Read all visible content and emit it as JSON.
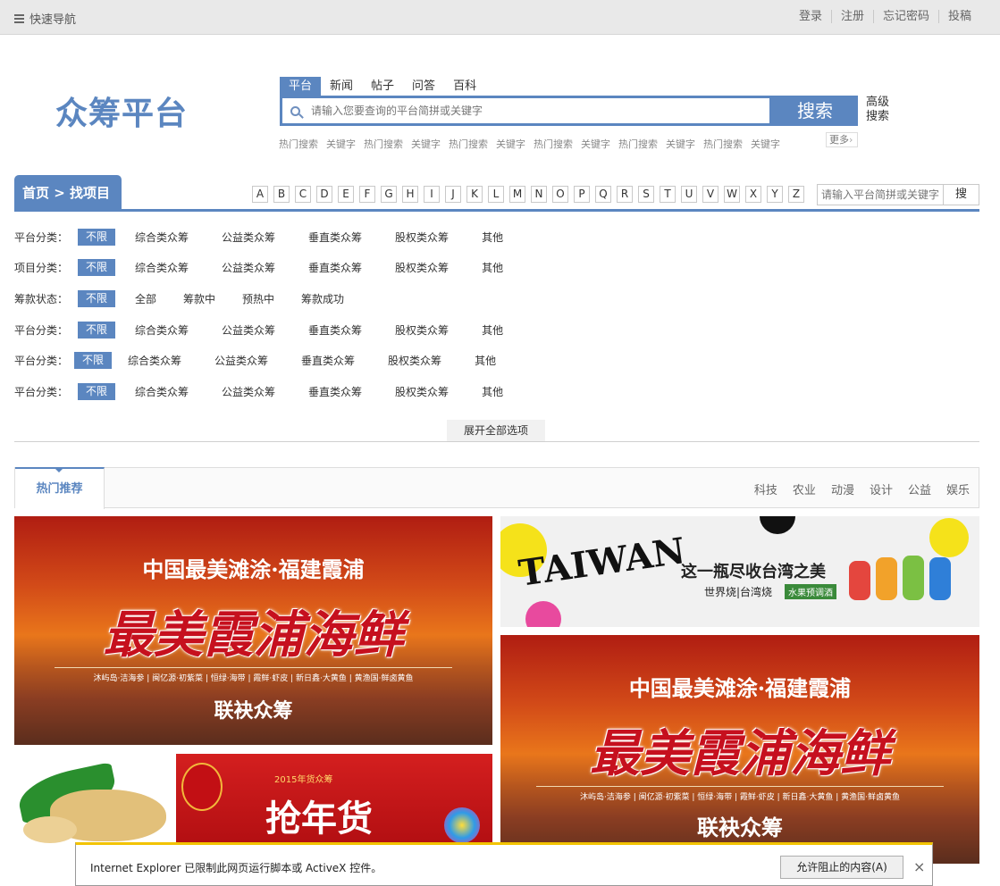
{
  "topbar": {
    "quick_nav": "快速导航",
    "links": [
      "登录",
      "注册",
      "忘记密码",
      "投稿"
    ]
  },
  "logo": "众筹平台",
  "search": {
    "tabs": [
      "平台",
      "新闻",
      "帖子",
      "问答",
      "百科"
    ],
    "placeholder": "请输入您要查询的平台简拼或关键字",
    "button": "搜索",
    "advanced_1": "高级",
    "advanced_2": "搜索",
    "hot": [
      "热门搜索",
      "关键字",
      "热门搜索",
      "关键字",
      "热门搜索",
      "关键字",
      "热门搜索",
      "关键字",
      "热门搜索",
      "关键字",
      "热门搜索",
      "关键字"
    ],
    "more": "更多"
  },
  "breadcrumb": "首页 > 找项目",
  "letters": [
    "A",
    "B",
    "C",
    "D",
    "E",
    "F",
    "G",
    "H",
    "I",
    "J",
    "K",
    "L",
    "M",
    "N",
    "O",
    "P",
    "Q",
    "R",
    "S",
    "T",
    "U",
    "V",
    "W",
    "X",
    "Y",
    "Z"
  ],
  "small_search": {
    "placeholder": "请输入平台简拼或关键字",
    "button": "搜"
  },
  "filters": [
    {
      "label": "平台分类：",
      "selected": "不限",
      "options": [
        "综合类众筹",
        "公益类众筹",
        "垂直类众筹",
        "股权类众筹",
        "其他"
      ]
    },
    {
      "label": "项目分类：",
      "selected": "不限",
      "options": [
        "综合类众筹",
        "公益类众筹",
        "垂直类众筹",
        "股权类众筹",
        "其他"
      ]
    },
    {
      "label": "筹款状态：",
      "selected": "不限",
      "options": [
        "全部",
        "筹款中",
        "预热中",
        "筹款成功"
      ]
    },
    {
      "label": "平台分类：",
      "selected": "不限",
      "options": [
        "综合类众筹",
        "公益类众筹",
        "垂直类众筹",
        "股权类众筹",
        "其他"
      ]
    },
    {
      "label": "平台分类：",
      "selected": "不限",
      "options": [
        "综合类众筹",
        "公益类众筹",
        "垂直类众筹",
        "股权类众筹",
        "其他"
      ]
    },
    {
      "label": "平台分类：",
      "selected": "不限",
      "options": [
        "综合类众筹",
        "公益类众筹",
        "垂直类众筹",
        "股权类众筹",
        "其他"
      ]
    }
  ],
  "expand_all": "展开全部选项",
  "recommend": {
    "active_tab": "热门推荐",
    "categories": [
      "科技",
      "农业",
      "动漫",
      "设计",
      "公益",
      "娱乐"
    ]
  },
  "banners": {
    "seafood": {
      "line1": "中国最美滩涂·福建霞浦",
      "line2": "最美霞浦海鲜",
      "line3": "沐屿岛·洁海参 | 闽亿源·初紫菜 | 恒绿·海带 | 霞鲜·虾皮 | 新日鑫·大黄鱼 | 黄渔国·鲜卤黄鱼",
      "line4": "联袂众筹"
    },
    "taiwan": {
      "logo": "TAIWAN",
      "headline": "这一瓶尽收台湾之美",
      "sub": "世界烧|台湾烧",
      "tag": "水果预调酒"
    },
    "newyear": {
      "small": "2015年货众筹",
      "big": "抢年货"
    }
  },
  "ie_bar": {
    "message": "Internet Explorer 已限制此网页运行脚本或 ActiveX 控件。",
    "allow_button": "允许阻止的内容(A)",
    "close": "×"
  },
  "colors": {
    "accent": "#5b86c0",
    "ie_bar_border": "#f2c300"
  }
}
